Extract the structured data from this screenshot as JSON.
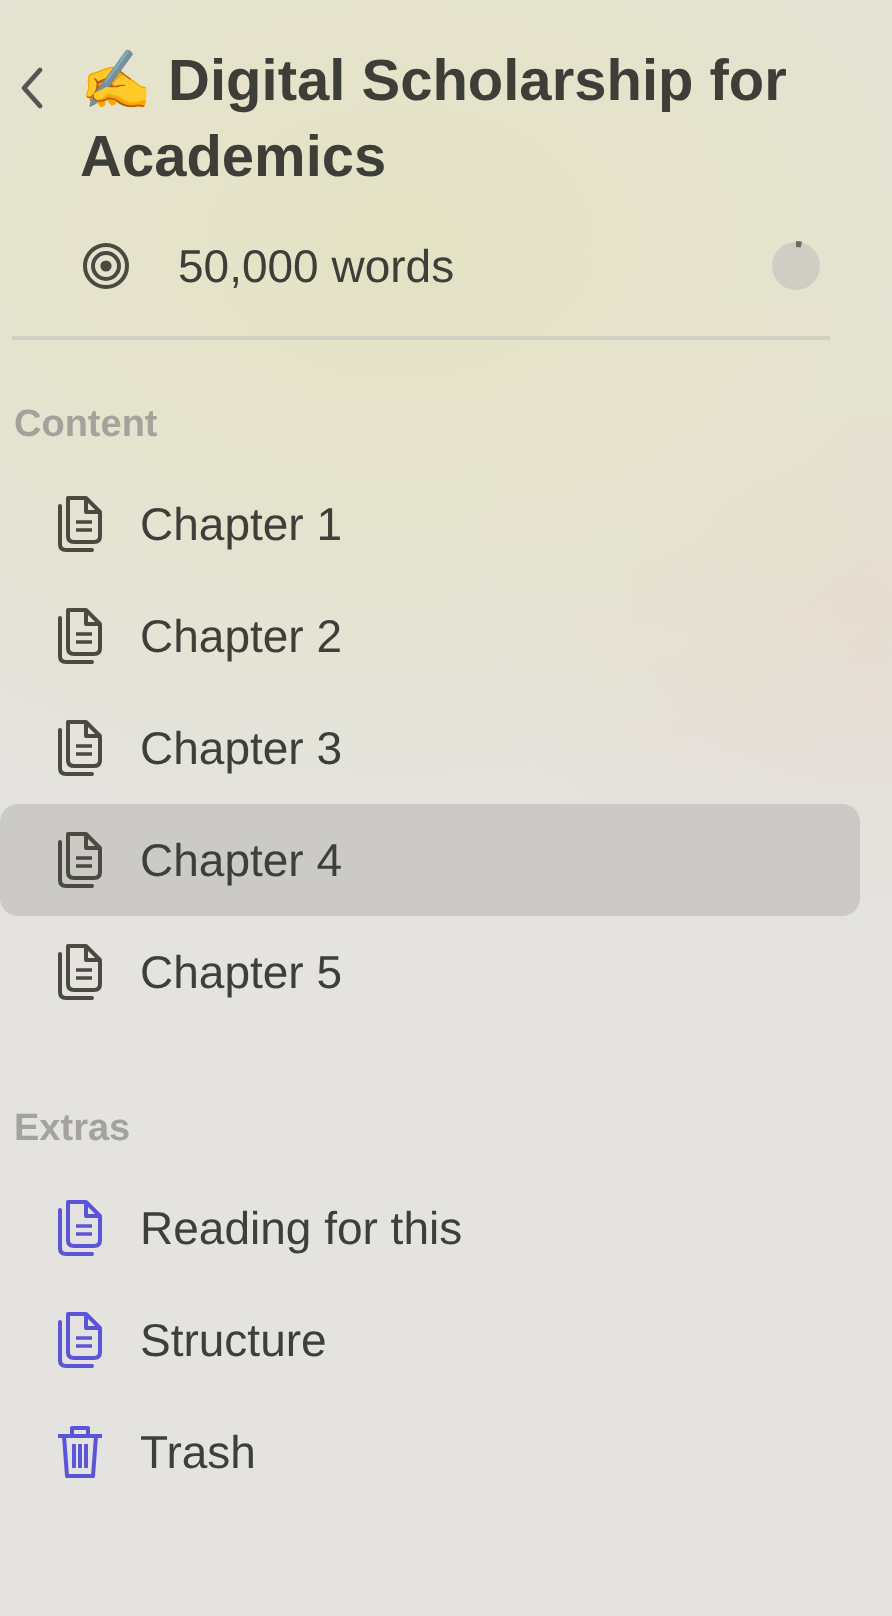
{
  "header": {
    "title": "✍️ Digital Scholarship for Academics",
    "goal": "50,000 words",
    "progress": {
      "level": 0.04
    }
  },
  "sections": [
    {
      "title": "Content",
      "items": [
        {
          "label": "Chapter 1",
          "kind": "document",
          "color": "#4a4a40",
          "selected": false
        },
        {
          "label": "Chapter 2",
          "kind": "document",
          "color": "#4a4a40",
          "selected": false
        },
        {
          "label": "Chapter 3",
          "kind": "document",
          "color": "#4a4a40",
          "selected": false
        },
        {
          "label": "Chapter 4",
          "kind": "document",
          "color": "#4a4a40",
          "selected": true
        },
        {
          "label": "Chapter 5",
          "kind": "document",
          "color": "#4a4a40",
          "selected": false
        }
      ]
    },
    {
      "title": "Extras",
      "items": [
        {
          "label": "Reading for this",
          "kind": "document",
          "color": "#5b55d8",
          "selected": false
        },
        {
          "label": "Structure",
          "kind": "document",
          "color": "#5b55d8",
          "selected": false
        },
        {
          "label": "Trash",
          "kind": "trash",
          "color": "#5b55d8",
          "selected": false
        }
      ]
    }
  ]
}
